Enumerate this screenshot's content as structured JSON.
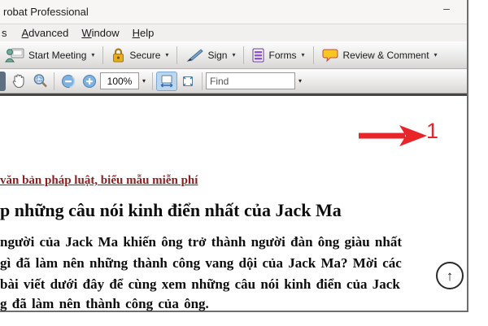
{
  "window": {
    "title": "robat Professional",
    "minimize_label": "–"
  },
  "menu": {
    "items": [
      {
        "initial": "",
        "rest": "s"
      },
      {
        "initial": "A",
        "rest": "dvanced"
      },
      {
        "initial": "W",
        "rest": "indow"
      },
      {
        "initial": "H",
        "rest": "elp"
      }
    ]
  },
  "toolbar_main": {
    "buttons": [
      {
        "label": "Start Meeting",
        "icon": "start-meeting-person-icon"
      },
      {
        "label": "Secure",
        "icon": "lock-icon"
      },
      {
        "label": "Sign",
        "icon": "pen-icon"
      },
      {
        "label": "Forms",
        "icon": "forms-icon"
      },
      {
        "label": "Review & Comment",
        "icon": "comment-bubble-icon"
      }
    ],
    "dropdown_glyph": "▾"
  },
  "toolbar_page": {
    "zoom_level": "100%",
    "dropdown_glyph": "▾",
    "find_placeholder": "Find",
    "tools": [
      "select-tool",
      "hand-tool",
      "zoom-marquee-tool",
      "zoom-out",
      "zoom-in",
      "fit-width",
      "fit-page"
    ]
  },
  "document": {
    "annotation_number": "1",
    "link_text": "văn bản pháp luật, biểu mẫu miễn phí",
    "heading": "p những câu nói kinh điển nhất của Jack Ma",
    "body_lines": [
      "người của Jack Ma khiến ông trở thành người đàn ông giàu nhất",
      "gì đã làm nên những thành công vang dội của Jack Ma? Mời các",
      "bài viết dưới đây để cùng xem những câu nói kinh điển của Jack",
      "g đã làm nên thành công của ông."
    ],
    "scroll_top_glyph": "↑"
  },
  "colors": {
    "annotation_red": "#e8262a",
    "link_maroon": "#8b2020",
    "lock_gold": "#e0a317",
    "forms_purple": "#8a4fc8",
    "bubble_yellow": "#f5c518",
    "fit_active_blue": "#bcd6ee"
  }
}
